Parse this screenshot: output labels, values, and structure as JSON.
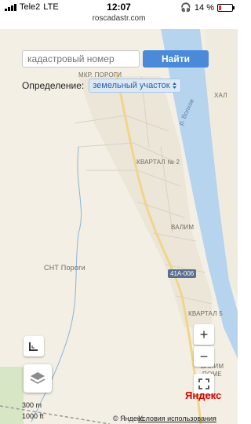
{
  "statusbar": {
    "carrier": "Tele2",
    "network": "LTE",
    "time": "12:07",
    "battery": "14 %"
  },
  "browser": {
    "url": "roscadastr.com"
  },
  "search": {
    "placeholder": "кадастровый номер",
    "button": "Найти"
  },
  "definition": {
    "label": "Определение:",
    "selected": "земельный участок"
  },
  "map_labels": {
    "district": "МКР. ПОРОГИ",
    "kvartal2": "КВАРТАЛ № 2",
    "valim": "ВАЛИМ",
    "snt": "СНТ Пороги",
    "kvartal_right": "КВАРТАЛ 5",
    "river": "р. Волхов",
    "hal": "ХАЛ",
    "road": "41А-006",
    "valim2": "ВАЛИМ",
    "pome": "ПОМЕ"
  },
  "controls": {
    "zoom_in": "+",
    "zoom_out": "−"
  },
  "scale": {
    "metric": "300 m",
    "imperial": "1000 ft"
  },
  "footer": {
    "copyright": "© Яндекс",
    "terms": "Условия использования"
  },
  "brand": {
    "logo": "Яндекс",
    "color": "#4a8ad8"
  }
}
